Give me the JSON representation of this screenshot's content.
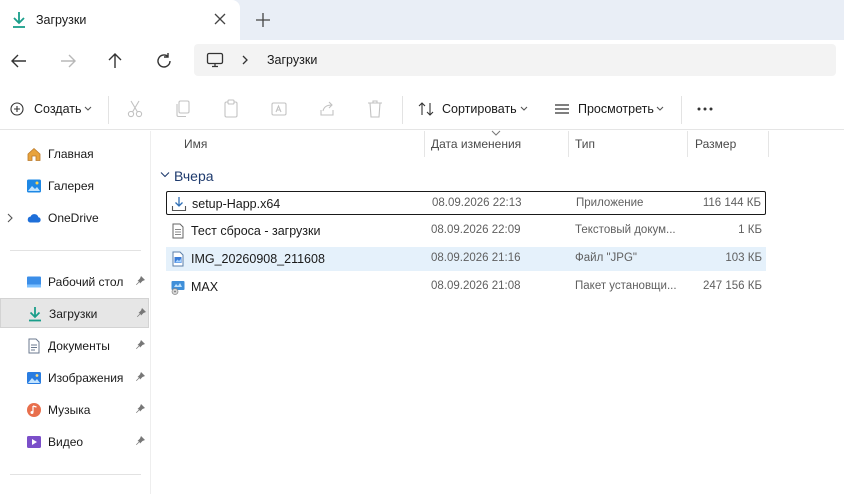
{
  "window": {
    "tab_title": "Загрузки"
  },
  "address": {
    "path": "Загрузки"
  },
  "toolbar": {
    "create_label": "Создать",
    "sort_label": "Сортировать",
    "view_label": "Просмотреть"
  },
  "sidebar": {
    "items": [
      {
        "label": "Главная",
        "icon": "home-icon"
      },
      {
        "label": "Галерея",
        "icon": "gallery-icon"
      },
      {
        "label": "OneDrive",
        "icon": "onedrive-icon"
      },
      {
        "label": "Рабочий стол",
        "icon": "desktop-icon",
        "pinned": true
      },
      {
        "label": "Загрузки",
        "icon": "downloads-icon",
        "pinned": true,
        "active": true
      },
      {
        "label": "Документы",
        "icon": "documents-icon",
        "pinned": true
      },
      {
        "label": "Изображения",
        "icon": "pictures-icon",
        "pinned": true
      },
      {
        "label": "Музыка",
        "icon": "music-icon",
        "pinned": true
      },
      {
        "label": "Видео",
        "icon": "video-icon",
        "pinned": true
      }
    ]
  },
  "columns": {
    "name": "Имя",
    "date": "Дата изменения",
    "type": "Тип",
    "size": "Размер"
  },
  "group": {
    "label": "Вчера"
  },
  "files": [
    {
      "name": "setup-Happ.x64",
      "date": "08.09.2026 22:13",
      "type": "Приложение",
      "size": "116 144 КБ",
      "icon": "setup-icon"
    },
    {
      "name": "Тест сброса - загрузки",
      "date": "08.09.2026 22:09",
      "type": "Текстовый докум...",
      "size": "1 КБ",
      "icon": "text-file-icon"
    },
    {
      "name": "IMG_20260908_211608",
      "date": "08.09.2026 21:16",
      "type": "Файл \"JPG\"",
      "size": "103 КБ",
      "icon": "image-file-icon"
    },
    {
      "name": "MAX",
      "date": "08.09.2026 21:08",
      "type": "Пакет установщи...",
      "size": "247 156 КБ",
      "icon": "installer-icon"
    }
  ],
  "colors": {
    "accent": "#0f7b6c",
    "selection": "#e5f1fb",
    "titlebar": "#e9eef6"
  }
}
